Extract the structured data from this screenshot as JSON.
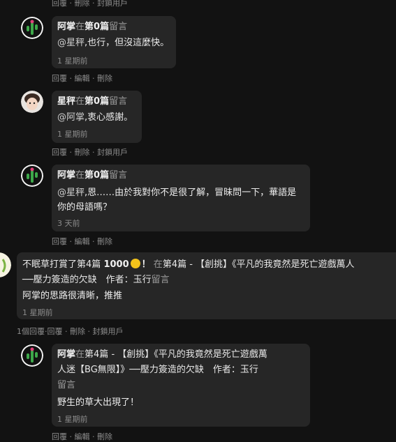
{
  "top_actions": {
    "reply": "回覆",
    "sep": "·",
    "delete": "刪除",
    "block": "封鎖用戶"
  },
  "comments": [
    {
      "author": "阿掌",
      "at": "在",
      "post": "第0篇",
      "suffix": "留言",
      "mention": "@星秤",
      "text": ",也行，但沒這麼快。",
      "time": "1 星期前",
      "actions": {
        "reply": "回覆",
        "edit": "編輯",
        "delete": "刪除"
      }
    },
    {
      "author": "星秤",
      "at": "在",
      "post": "第0篇",
      "suffix": "留言",
      "mention": "@阿掌",
      "text": ",衷心感謝。",
      "time": "1 星期前",
      "actions": {
        "reply": "回覆",
        "delete": "刪除",
        "block": "封鎖用戶"
      }
    },
    {
      "author": "阿掌",
      "at": "在",
      "post": "第0篇",
      "suffix": "留言",
      "mention": "@星秤",
      "text_line1": ",恩……由於我對你不是很了解，冒昧問一下，華語是",
      "text_line2": "你的母語嗎？",
      "time": "3 天前",
      "actions": {
        "reply": "回覆",
        "edit": "編輯",
        "delete": "刪除"
      }
    }
  ],
  "tip": {
    "author": "不眠草",
    "action": "打賞了",
    "post": "第4篇",
    "amount": "1000",
    "excl": "！",
    "at": "在",
    "post2": "第4篇",
    "title_line1": " - 【創挑】《平凡的我竟然是死亡遊戲萬人",
    "title_line2": "──壓力簽造的欠缺　作者：玉行",
    "suffix": "留言",
    "text": "阿掌的思路很清晰，推推",
    "time": "1 星期前",
    "actions": {
      "count": "1個回覆",
      "reply": "回覆",
      "delete": "刪除",
      "block": "封鎖用戶"
    }
  },
  "reply4": {
    "author": "阿掌",
    "at": "在",
    "post": "第4篇",
    "title_line1": " - 【創挑】《平凡的我竟然是死亡遊戲萬",
    "title_line2": "人迷【BG無限】》──壓力簽造的欠缺　作者：玉行",
    "suffix": "留言",
    "text": "野生的草大出現了！",
    "time": "1 星期前",
    "actions": {
      "reply": "回覆",
      "edit": "編輯",
      "delete": "刪除"
    }
  }
}
